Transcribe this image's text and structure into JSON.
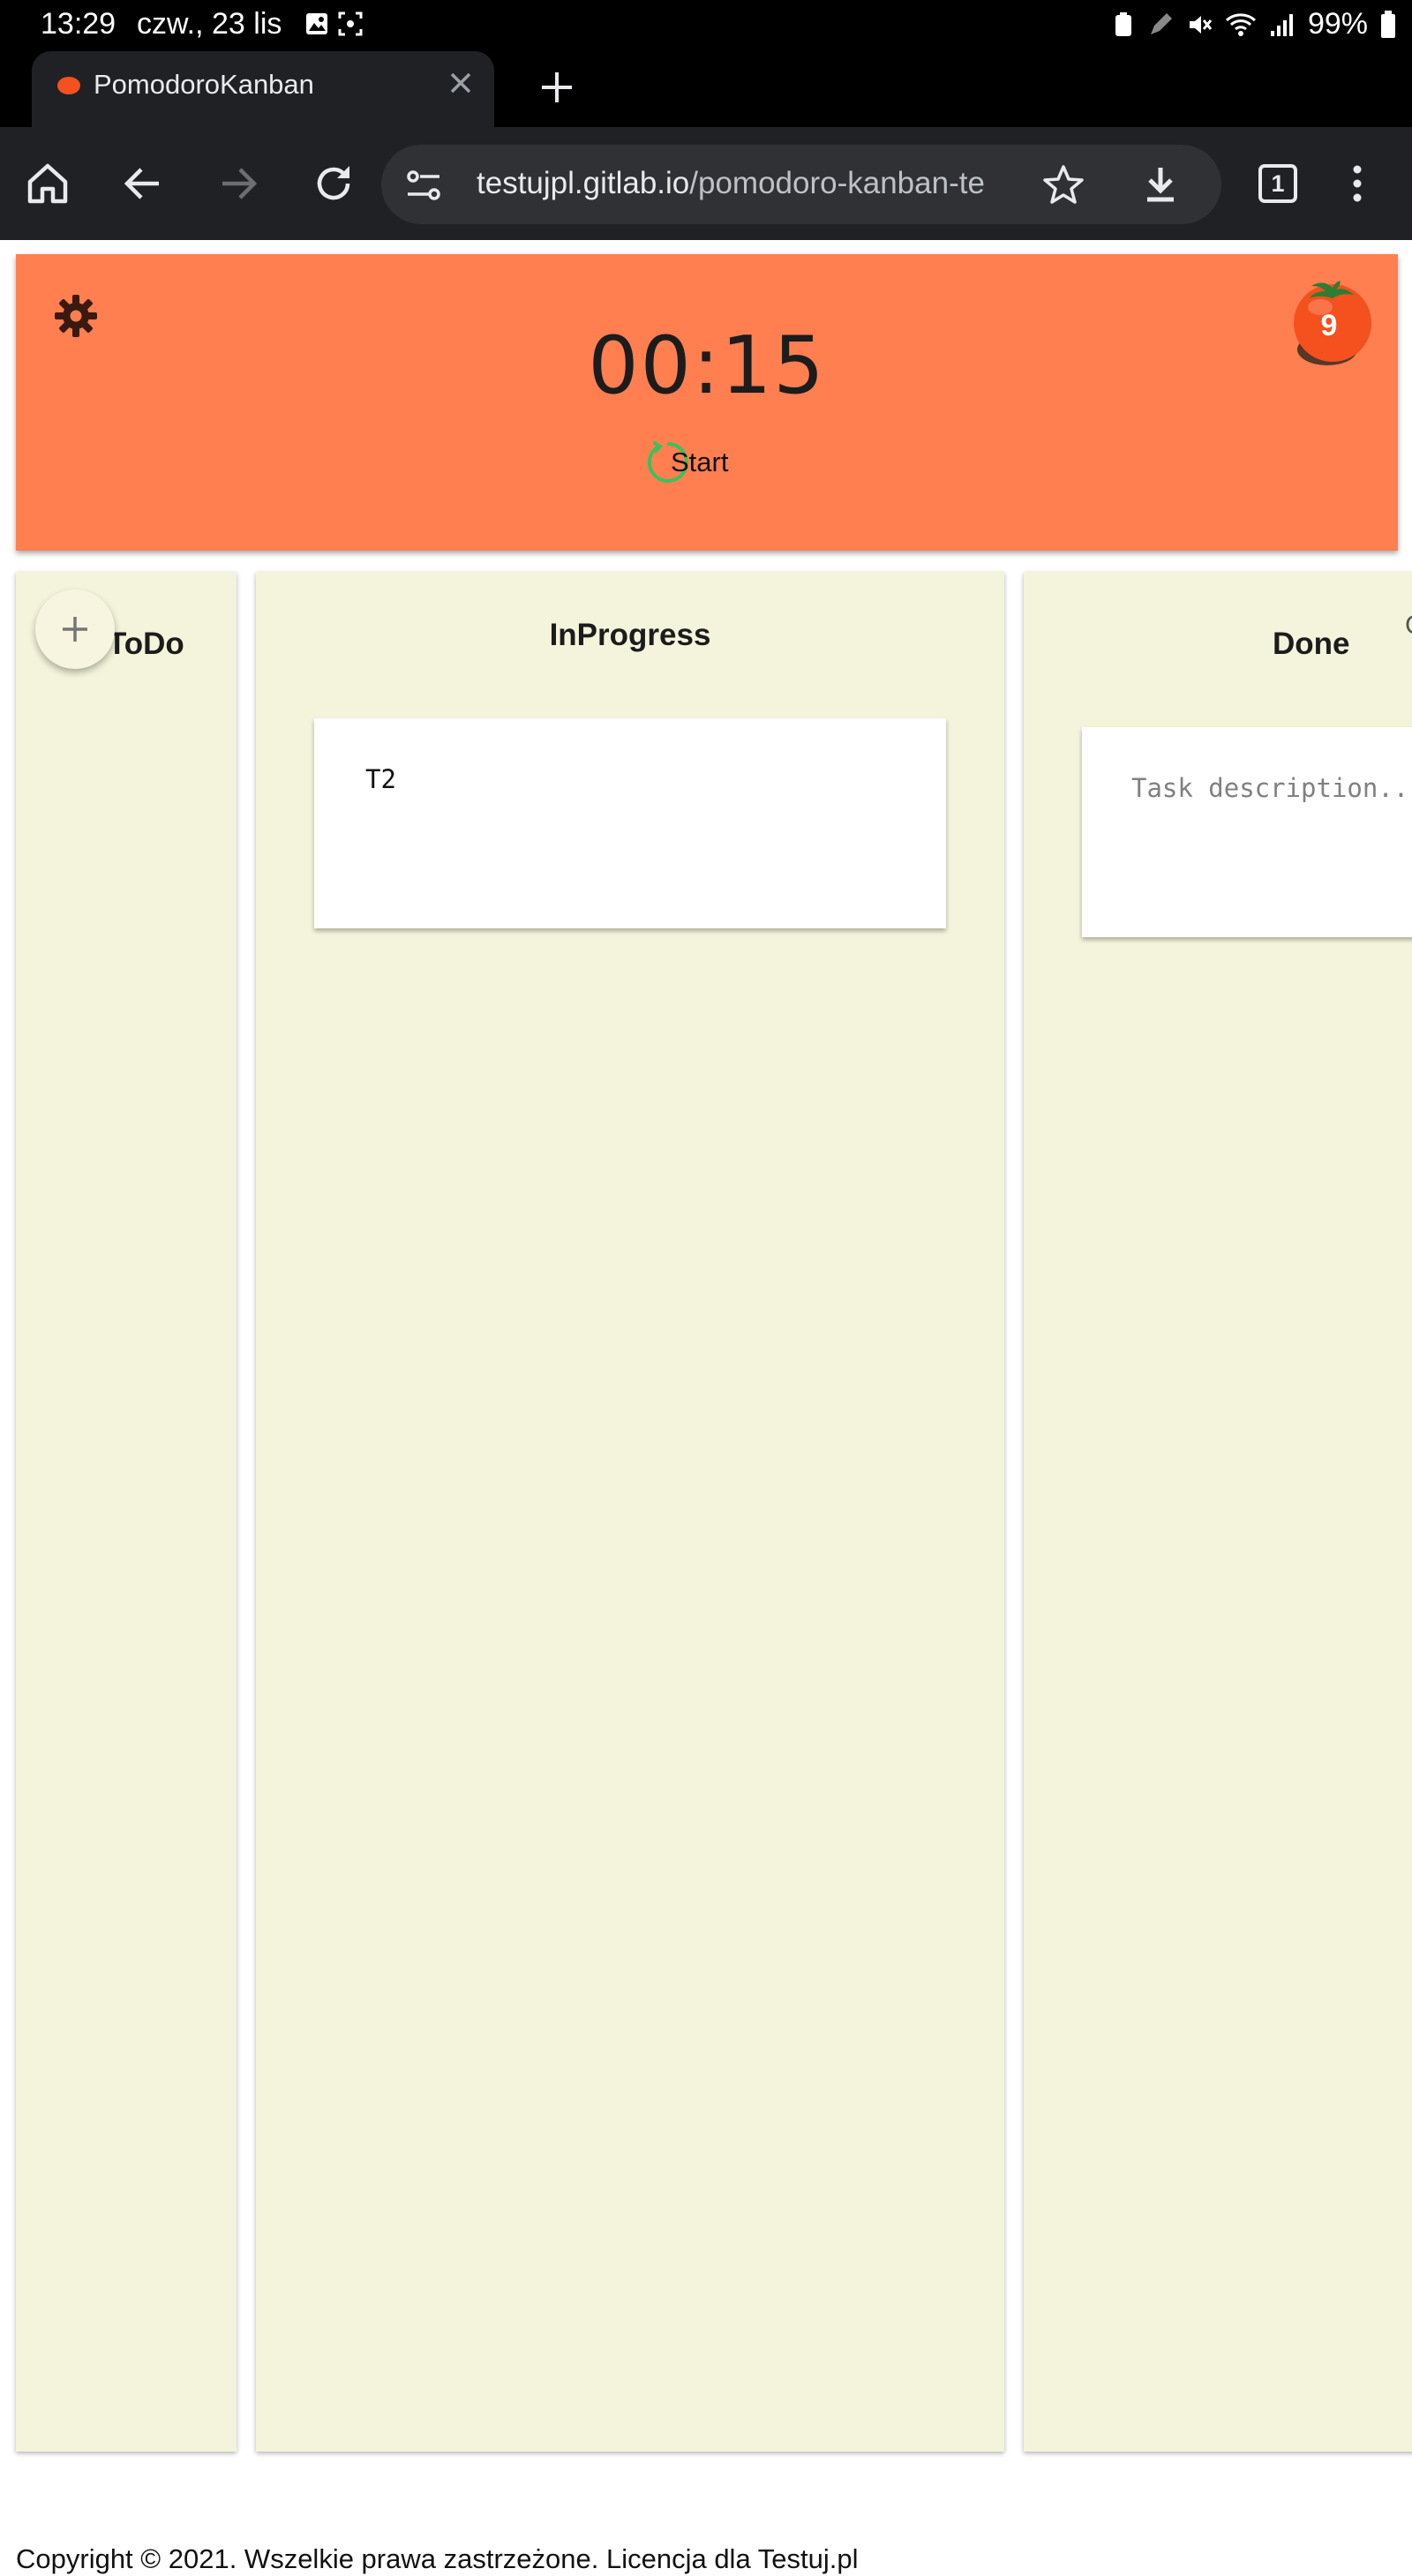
{
  "status_bar": {
    "time": "13:29",
    "date": "czw., 23 lis",
    "battery": "99%"
  },
  "browser": {
    "tab_title": "PomodoroKanban",
    "url_host": "testujpl.gitlab.io",
    "url_path": "/pomodoro-kanban-te",
    "tab_count": "1"
  },
  "header": {
    "timer": "00:15",
    "start_label": "Start",
    "pomodoro_count": "9",
    "accent_color": "#ff7f50"
  },
  "board": {
    "columns": [
      {
        "title": "ToDo",
        "cards": []
      },
      {
        "title": "InProgress",
        "cards": [
          {
            "text": "T2"
          }
        ]
      },
      {
        "title": "Done",
        "cards": [
          {
            "text": "",
            "placeholder": "Task description..."
          }
        ]
      }
    ],
    "done_edge_text": "C",
    "column_color": "#f4f4dc"
  },
  "footer": {
    "text": "Copyright © 2021. Wszelkie prawa zastrzeżone. Licencja dla Testuj.pl"
  }
}
